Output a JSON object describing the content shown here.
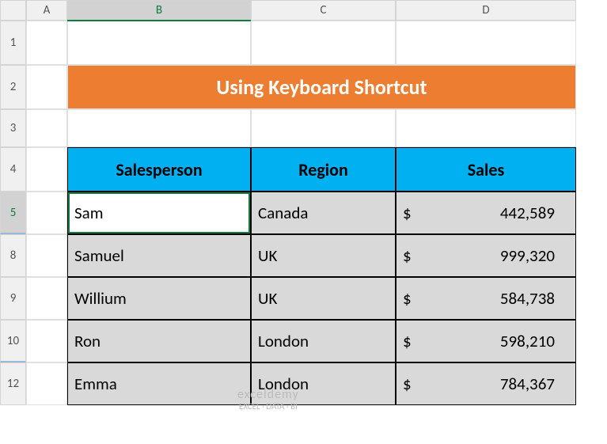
{
  "columns": [
    "",
    "A",
    "B",
    "C",
    "D"
  ],
  "visible_rows": [
    "1",
    "2",
    "3",
    "4",
    "5",
    "8",
    "9",
    "10",
    "12"
  ],
  "row_heights": {
    "1": 56,
    "2": 56,
    "3": 48,
    "4": 56,
    "5": 54,
    "8": 54,
    "9": 54,
    "10": 54,
    "12": 54
  },
  "selected_row": "5",
  "selected_col": "B",
  "title": "Using Keyboard Shortcut",
  "headers": {
    "salesperson": "Salesperson",
    "region": "Region",
    "sales": "Sales"
  },
  "currency": "$",
  "chart_data": {
    "type": "table",
    "columns": [
      "Salesperson",
      "Region",
      "Sales"
    ],
    "rows": [
      {
        "salesperson": "Sam",
        "region": "Canada",
        "sales": 442589,
        "sales_fmt": "442,589"
      },
      {
        "salesperson": "Samuel",
        "region": "UK",
        "sales": 999320,
        "sales_fmt": "999,320"
      },
      {
        "salesperson": "Willium",
        "region": "UK",
        "sales": 584738,
        "sales_fmt": "584,738"
      },
      {
        "salesperson": "Ron",
        "region": "London",
        "sales": 598210,
        "sales_fmt": "598,210"
      },
      {
        "salesperson": "Emma",
        "region": "London",
        "sales": 784367,
        "sales_fmt": "784,367"
      }
    ]
  },
  "watermark": {
    "brand": "exceldemy",
    "tag": "EXCEL · DATA · BI"
  }
}
